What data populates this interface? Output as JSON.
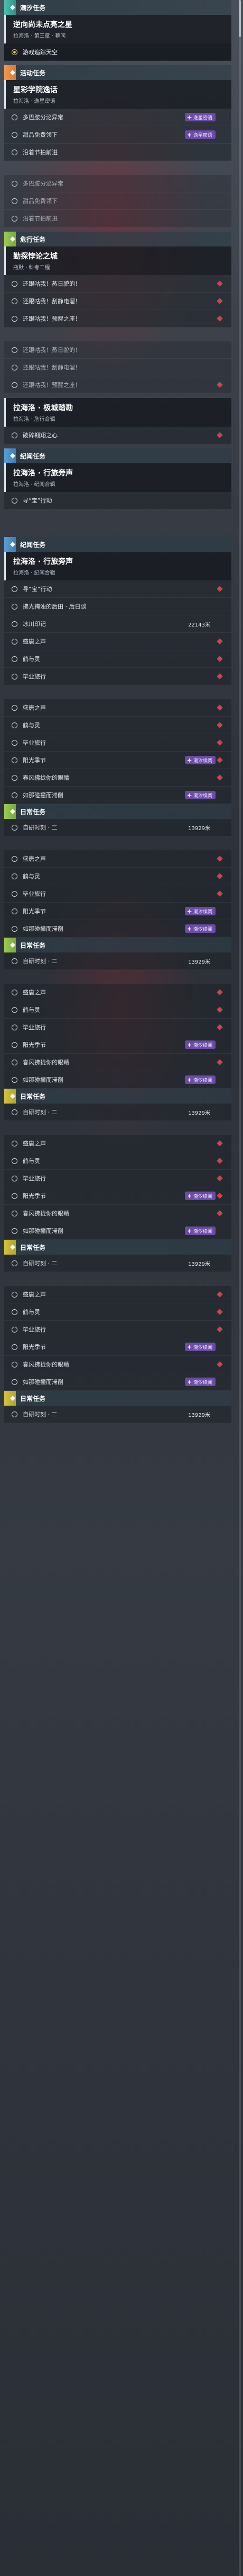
{
  "sections": [
    {
      "kind": "header",
      "color": "teal",
      "label": "潮汐任务"
    },
    {
      "kind": "title",
      "name": "逆向尚未点亮之星",
      "sub": "拉海洛 · 第三章 · 幕间"
    },
    {
      "kind": "row",
      "text": "游戏追踪天空",
      "style": "hl",
      "ring": "gold"
    },
    {
      "kind": "gap"
    },
    {
      "kind": "header",
      "color": "orange",
      "label": "活动任务"
    },
    {
      "kind": "title",
      "name": "星彩学院逸话",
      "sub": "拉海洛 · 逸星密语"
    },
    {
      "kind": "row",
      "text": "多巴胺分泌异常",
      "tag": "逸星密语"
    },
    {
      "kind": "row",
      "text": "甜品免费领下",
      "tag": "逸星密语"
    },
    {
      "kind": "row",
      "text": "沿着节拍前进"
    },
    {
      "kind": "gap-l"
    },
    {
      "kind": "row",
      "text": "多巴胺分泌异常",
      "style": "dim"
    },
    {
      "kind": "row",
      "text": "甜品免费领下",
      "style": "dim"
    },
    {
      "kind": "row",
      "text": "沿着节拍前进",
      "style": "dim"
    },
    {
      "kind": "gap"
    },
    {
      "kind": "header",
      "color": "green",
      "label": "危行任务"
    },
    {
      "kind": "title",
      "name": "勤探悖论之城",
      "sub": "瓶默 · 科考工程"
    },
    {
      "kind": "row",
      "text": "还跟咕我！蒸日貌的！",
      "diamond": true
    },
    {
      "kind": "row",
      "text": "还跟咕我！刮静电溜！",
      "diamond": true
    },
    {
      "kind": "row",
      "text": "还跟咕我！预醒之座！",
      "diamond": true
    },
    {
      "kind": "gap-l"
    },
    {
      "kind": "row",
      "text": "还跟咕我！蒸日貌的！",
      "style": "dim"
    },
    {
      "kind": "row",
      "text": "还跟咕我！刮静电溜！",
      "style": "dim"
    },
    {
      "kind": "row",
      "text": "还跟咕我！预醒之座！",
      "style": "dim",
      "diamond": true
    },
    {
      "kind": "gap"
    },
    {
      "kind": "title",
      "name": "拉海洛 · 极城踏勘",
      "sub": "拉海洛 · 危行合辑"
    },
    {
      "kind": "row",
      "text": "破碎翱翔之心",
      "diamond": true
    },
    {
      "kind": "gap"
    },
    {
      "kind": "header",
      "color": "blue",
      "label": "纪闻任务"
    },
    {
      "kind": "title",
      "name": "拉海洛 · 行旅旁声",
      "sub": "拉海洛 · 纪闻合辑"
    },
    {
      "kind": "row",
      "text": "寻“宝”行动"
    },
    {
      "kind": "gap-l"
    },
    {
      "kind": "gap-l"
    },
    {
      "kind": "header",
      "color": "blue",
      "label": "纪闻任务"
    },
    {
      "kind": "title",
      "name": "拉海洛 · 行旅旁声",
      "sub": "拉海洛 · 纪闻合辑"
    },
    {
      "kind": "row",
      "text": "寻“宝”行动",
      "diamond": true
    },
    {
      "kind": "row",
      "text": "拂光掩浊的后田 · 后日谈"
    },
    {
      "kind": "row",
      "text": "冰川印记",
      "val": "22143米"
    },
    {
      "kind": "row",
      "text": "盛唐之声",
      "diamond": true
    },
    {
      "kind": "row",
      "text": "鹤与灵",
      "diamond": true
    },
    {
      "kind": "row",
      "text": "毕业旅行",
      "diamond": true
    },
    {
      "kind": "gap-l"
    },
    {
      "kind": "row",
      "text": "盛唐之声",
      "diamond": true
    },
    {
      "kind": "row",
      "text": "鹤与灵",
      "diamond": true
    },
    {
      "kind": "row",
      "text": "毕业旅行",
      "diamond": true
    },
    {
      "kind": "row",
      "text": "阳光季节",
      "tag": "潮汐续阅",
      "diamond": true
    },
    {
      "kind": "row",
      "text": "春风拂拢你的眼睛",
      "diamond": true
    },
    {
      "kind": "row",
      "text": "如那碰撞而滞削",
      "tag": "潮汐续阅"
    },
    {
      "kind": "header",
      "color": "green",
      "label": "日常任务"
    },
    {
      "kind": "row",
      "text": "自研时刻 · 二",
      "val": "13929米"
    },
    {
      "kind": "gap-l"
    },
    {
      "kind": "row",
      "text": "盛唐之声",
      "diamond": true
    },
    {
      "kind": "row",
      "text": "鹤与灵",
      "diamond": true
    },
    {
      "kind": "row",
      "text": "毕业旅行",
      "diamond": true
    },
    {
      "kind": "row",
      "text": "阳光季节",
      "tag": "潮汐续阅"
    },
    {
      "kind": "row",
      "text": "如那碰撞而滞削",
      "tag": "潮汐续阅"
    },
    {
      "kind": "header",
      "color": "green",
      "label": "日常任务"
    },
    {
      "kind": "row",
      "text": "自研时刻 · 二",
      "val": "13929米"
    },
    {
      "kind": "gap-l"
    },
    {
      "kind": "row",
      "text": "盛唐之声",
      "diamond": true
    },
    {
      "kind": "row",
      "text": "鹤与灵",
      "diamond": true
    },
    {
      "kind": "row",
      "text": "毕业旅行",
      "diamond": true
    },
    {
      "kind": "row",
      "text": "阳光季节",
      "tag": "潮汐续阅"
    },
    {
      "kind": "row",
      "text": "春风拂拢你的眼睛",
      "diamond": true
    },
    {
      "kind": "row",
      "text": "如那碰撞而滞削",
      "tag": "潮汐续阅"
    },
    {
      "kind": "header",
      "color": "yellow",
      "label": "日常任务"
    },
    {
      "kind": "row",
      "text": "自研时刻 · 二",
      "val": "13929米"
    },
    {
      "kind": "gap-l"
    },
    {
      "kind": "row",
      "text": "盛唐之声",
      "diamond": true
    },
    {
      "kind": "row",
      "text": "鹤与灵",
      "diamond": true
    },
    {
      "kind": "row",
      "text": "毕业旅行",
      "diamond": true
    },
    {
      "kind": "row",
      "text": "阳光季节",
      "tag": "潮汐续阅",
      "diamond": true
    },
    {
      "kind": "row",
      "text": "春风拂拢你的眼睛",
      "diamond": true
    },
    {
      "kind": "row",
      "text": "如那碰撞而滞削",
      "tag": "潮汐续阅"
    },
    {
      "kind": "header",
      "color": "yellow",
      "label": "日常任务"
    },
    {
      "kind": "row",
      "text": "自研时刻 · 二",
      "val": "13929米"
    },
    {
      "kind": "gap-l"
    },
    {
      "kind": "row",
      "text": "盛唐之声",
      "diamond": true
    },
    {
      "kind": "row",
      "text": "鹤与灵",
      "diamond": true
    },
    {
      "kind": "row",
      "text": "毕业旅行",
      "diamond": true
    },
    {
      "kind": "row",
      "text": "阳光季节",
      "tag": "潮汐续阅"
    },
    {
      "kind": "row",
      "text": "春风拂拢你的眼睛",
      "diamond": true
    },
    {
      "kind": "row",
      "text": "如那碰撞而滞削",
      "tag": "潮汐续阅"
    },
    {
      "kind": "header",
      "color": "yellow",
      "label": "日常任务"
    },
    {
      "kind": "row",
      "text": "自研时刻 · 二",
      "val": "13929米"
    }
  ]
}
